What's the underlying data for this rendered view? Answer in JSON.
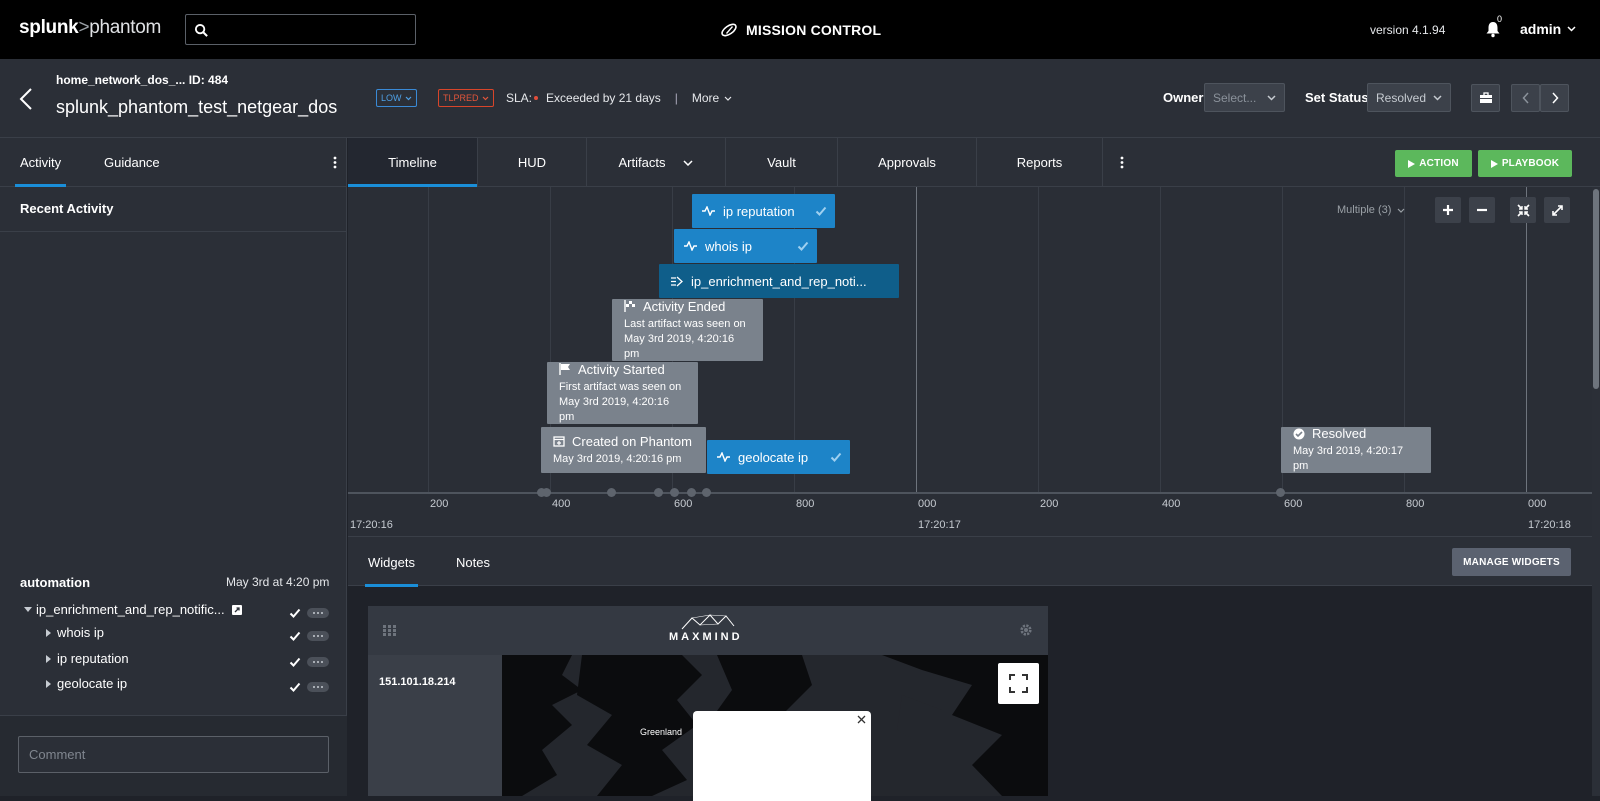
{
  "topbar": {
    "logo_splunk": "splunk",
    "logo_gt": ">",
    "logo_phantom": "phantom",
    "mission_control": "MISSION CONTROL",
    "version": "version 4.1.94",
    "notification_count": "0",
    "user": "admin"
  },
  "case": {
    "subtitle_name": "home_network_dos_...",
    "subtitle_id": "ID: 484",
    "name": "splunk_phantom_test_netgear_dos",
    "severity": "LOW",
    "tlp": "TLPRED",
    "sla_label": "SLA:",
    "sla_value": "Exceeded by 21 days",
    "separator": "|",
    "more": "More",
    "owner_label": "Owner",
    "owner_placeholder": "Select...",
    "status_label": "Set Status",
    "status_value": "Resolved"
  },
  "left": {
    "tabs": [
      "Activity",
      "Guidance"
    ],
    "recent_activity": "Recent Activity",
    "automation_title": "automation",
    "automation_time": "May 3rd at 4:20 pm",
    "playbook": "ip_enrichment_and_rep_notific...",
    "actions": [
      "whois ip",
      "ip reputation",
      "geolocate ip"
    ],
    "comment_placeholder": "Comment"
  },
  "main_tabs": [
    "Timeline",
    "HUD",
    "Artifacts",
    "Vault",
    "Approvals",
    "Reports"
  ],
  "buttons": {
    "action": "ACTION",
    "playbook": "PLAYBOOK",
    "manage_widgets": "MANAGE WIDGETS"
  },
  "timeline": {
    "multiple": "Multiple (3)",
    "ticks": [
      "200",
      "400",
      "600",
      "800",
      "000",
      "200",
      "400",
      "600",
      "800",
      "000"
    ],
    "timestamps": [
      "17:20:16",
      "17:20:17",
      "17:20:18"
    ],
    "events": {
      "ip_reputation": "ip reputation",
      "whois_ip": "whois ip",
      "playbook_run": "ip_enrichment_and_rep_noti...",
      "activity_ended_title": "Activity Ended",
      "activity_ended_sub1": "Last artifact was seen on",
      "activity_ended_sub2": "May 3rd 2019, 4:20:16 pm",
      "activity_started_title": "Activity Started",
      "activity_started_sub1": "First artifact was seen on",
      "activity_started_sub2": "May 3rd 2019, 4:20:16 pm",
      "created_title": "Created on Phantom",
      "created_sub": "May 3rd 2019, 4:20:16 pm",
      "geolocate_ip": "geolocate ip",
      "resolved_title": "Resolved",
      "resolved_sub": "May 3rd 2019, 4:20:17 pm"
    }
  },
  "widget_tabs": [
    "Widgets",
    "Notes"
  ],
  "widget": {
    "brand": "MAXMIND",
    "ip": "151.101.18.214",
    "map_label": "Greenland"
  },
  "colors": {
    "accent": "#1a8ed8",
    "green": "#5cb85c",
    "event_blue": "#1d84c8",
    "event_gray": "#7a828c"
  }
}
